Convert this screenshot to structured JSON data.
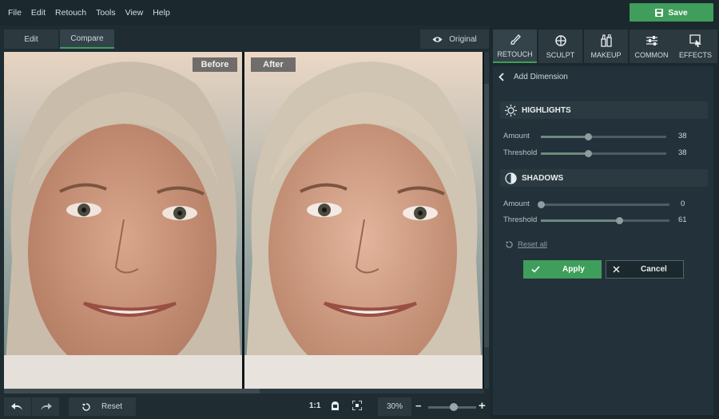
{
  "menu": [
    "File",
    "Edit",
    "Retouch",
    "Tools",
    "View",
    "Help"
  ],
  "save_label": "Save",
  "view_tabs": {
    "edit": "Edit",
    "compare": "Compare"
  },
  "original_label": "Original",
  "compare": {
    "before": "Before",
    "after": "After"
  },
  "tools": [
    {
      "label": "RETOUCH",
      "icon": "retouch-brush-icon",
      "active": true
    },
    {
      "label": "SCULPT",
      "icon": "sculpt-icon",
      "active": false
    },
    {
      "label": "MAKEUP",
      "icon": "makeup-icon",
      "active": false
    },
    {
      "label": "COMMON",
      "icon": "sliders-icon",
      "active": false
    },
    {
      "label": "EFFECTS",
      "icon": "effects-icon",
      "active": false
    }
  ],
  "panel": {
    "back_label": "Add Dimension",
    "highlights": {
      "title": "HIGHLIGHTS",
      "amount_label": "Amount",
      "amount": "38",
      "amount_frac": 0.38,
      "threshold_label": "Threshold",
      "threshold": "38",
      "threshold_frac": 0.38
    },
    "shadows": {
      "title": "SHADOWS",
      "amount_label": "Amount",
      "amount": "0",
      "amount_frac": 0.0,
      "threshold_label": "Threshold",
      "threshold": "61",
      "threshold_frac": 0.61
    },
    "reset_all": "Reset all",
    "apply_label": "Apply",
    "cancel_label": "Cancel"
  },
  "bottom": {
    "reset_label": "Reset",
    "one_to_one": "1:1",
    "zoom": "30%",
    "zoom_frac": 0.5
  },
  "colors": {
    "accent": "#3f9e5b",
    "panel": "#1b282e",
    "background": "#1f2d33"
  }
}
